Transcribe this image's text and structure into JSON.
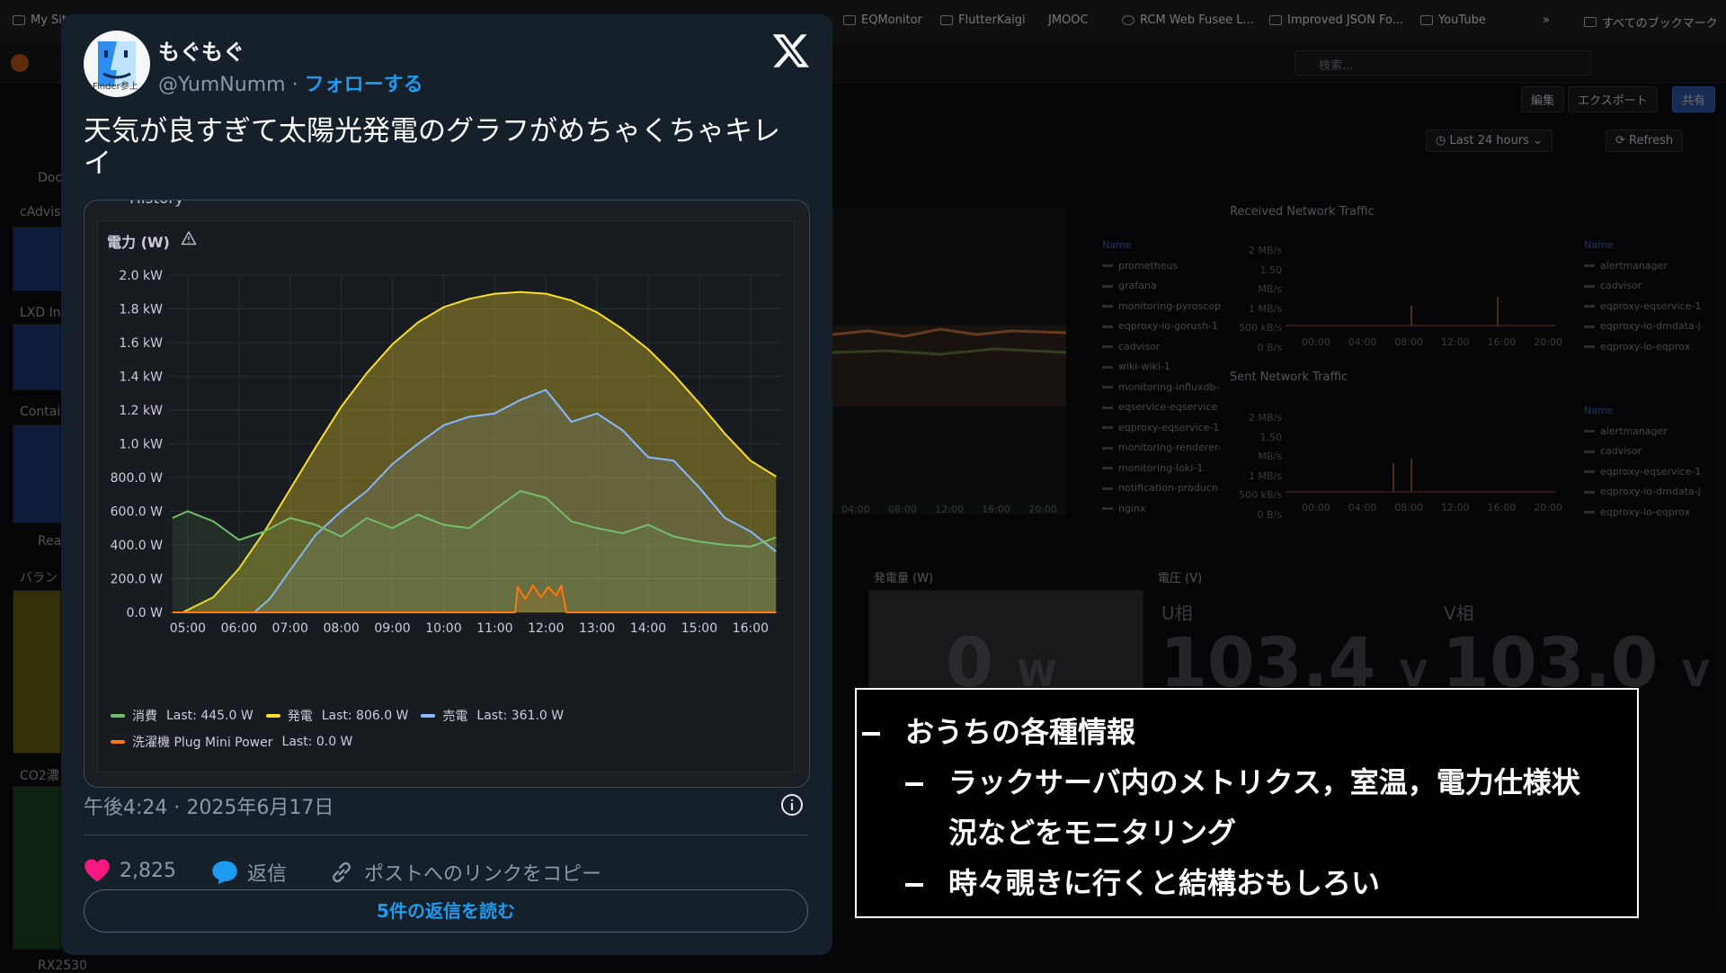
{
  "browser": {
    "bookmarks": [
      "My Sites",
      "EQMonitor",
      "FlutterKaigi",
      "JMOOC",
      "RCM Web Fusee L...",
      "Improved JSON Fo...",
      "YouTube",
      "すべてのブックマーク"
    ]
  },
  "grafana": {
    "search_placeholder": "検索...",
    "buttons": [
      "編集",
      "エクスポート",
      "共有"
    ],
    "time_range": "Last 24 hours",
    "refresh_label": "Refresh",
    "sidebar_labels": [
      "Doc",
      "cAdvis",
      "LXD In",
      "Contai",
      "Rea",
      "バラン",
      "CO2濃",
      "RX2530"
    ],
    "received_title": "Received Network Traffic",
    "sent_title": "Sent Network Traffic",
    "net_y_ticks": [
      "2 MB/s",
      "1.50 MB/s",
      "1 MB/s",
      "500 kB/s",
      "0 B/s"
    ],
    "net_x_ticks": [
      "00:00",
      "04:00",
      "08:00",
      "12:00",
      "16:00",
      "20:00"
    ],
    "left_x_ticks": [
      "04:00",
      "08:00",
      "12:00",
      "16:00",
      "20:00"
    ],
    "legend_header": "Name",
    "legend_left": [
      "prometheus",
      "grafana",
      "monitoring-pyroscop",
      "eqproxy-io-gorush-1",
      "cadvisor",
      "wiki-wiki-1",
      "monitoring-influxdb-",
      "eqservice-eqservice",
      "eqproxy-eqservice-1",
      "monitoring-renderer-",
      "monitoring-loki-1",
      "notification-producn",
      "nginx"
    ],
    "legend_right": [
      "alertmanager",
      "cadvisor",
      "eqproxy-eqservice-1",
      "eqproxy-io-dmdata-j",
      "eqproxy-io-eqprox"
    ],
    "gen_title": "発電量 (W)",
    "gen_value": "0",
    "gen_unit": "W",
    "volt_title": "電圧 (V)",
    "u_label": "U相",
    "u_value": "103.4",
    "v_label": "V相",
    "v_value": "103.0",
    "volt_unit": "V"
  },
  "tweet": {
    "author_name": "もぐもぐ",
    "handle": "@YumNumm",
    "separator": "·",
    "follow_label": "フォローする",
    "avatar_text": "Finder参上",
    "text": "天気が良すぎて太陽光発電のグラフがめちゃくちゃキレイ",
    "chart_header_partial": "History",
    "timestamp": "午後4:24 · 2025年6月17日",
    "likes": "2,825",
    "reply_label": "返信",
    "copy_link_label": "ポストへのリンクをコピー",
    "read_replies_label": "5件の返信を読む"
  },
  "chart_data": {
    "type": "line",
    "title": "電力 (W)",
    "y_ticks": [
      "0.0 W",
      "200.0 W",
      "400.0 W",
      "600.0 W",
      "800.0 W",
      "1.0 kW",
      "1.2 kW",
      "1.4 kW",
      "1.6 kW",
      "1.8 kW",
      "2.0 kW"
    ],
    "ylim": [
      0,
      2000
    ],
    "x_ticks": [
      "05:00",
      "06:00",
      "07:00",
      "08:00",
      "09:00",
      "10:00",
      "11:00",
      "12:00",
      "13:00",
      "14:00",
      "15:00",
      "16:00"
    ],
    "xlim": [
      4.65,
      16.6
    ],
    "series": [
      {
        "name": "消費",
        "color": "#73bf69",
        "last": "Last: 445.0 W",
        "x": [
          4.7,
          5.0,
          5.5,
          6.0,
          6.5,
          7.0,
          7.5,
          8.0,
          8.5,
          9.0,
          9.5,
          10.0,
          10.5,
          11.0,
          11.5,
          12.0,
          12.5,
          13.0,
          13.5,
          14.0,
          14.5,
          15.0,
          15.5,
          16.0,
          16.5
        ],
        "y": [
          560,
          600,
          540,
          430,
          480,
          560,
          520,
          450,
          560,
          500,
          580,
          520,
          500,
          610,
          720,
          680,
          540,
          500,
          470,
          520,
          450,
          420,
          400,
          390,
          445
        ]
      },
      {
        "name": "発電",
        "color": "#fade2a",
        "last": "Last: 806.0 W",
        "x": [
          4.9,
          5.5,
          6.0,
          6.5,
          7.0,
          7.5,
          8.0,
          8.5,
          9.0,
          9.5,
          10.0,
          10.5,
          11.0,
          11.5,
          12.0,
          12.5,
          13.0,
          13.5,
          14.0,
          14.5,
          15.0,
          15.5,
          16.0,
          16.5
        ],
        "y": [
          0,
          90,
          260,
          480,
          730,
          980,
          1220,
          1420,
          1590,
          1720,
          1810,
          1860,
          1890,
          1900,
          1890,
          1850,
          1780,
          1680,
          1560,
          1410,
          1240,
          1060,
          900,
          806
        ]
      },
      {
        "name": "売電",
        "color": "#8ab8ff",
        "last": "Last: 361.0 W",
        "x": [
          6.3,
          6.6,
          7.0,
          7.5,
          8.0,
          8.5,
          9.0,
          9.5,
          10.0,
          10.5,
          11.0,
          11.5,
          12.0,
          12.5,
          13.0,
          13.5,
          14.0,
          14.5,
          15.0,
          15.5,
          16.0,
          16.5
        ],
        "y": [
          0,
          80,
          250,
          460,
          600,
          720,
          880,
          1000,
          1110,
          1160,
          1180,
          1260,
          1320,
          1130,
          1180,
          1080,
          920,
          900,
          740,
          560,
          480,
          361
        ]
      },
      {
        "name": "洗濯機 Plug Mini Power",
        "color": "#ff780a",
        "last": "Last: 0.0 W",
        "x": [
          4.7,
          11.4,
          11.45,
          11.6,
          11.75,
          11.9,
          12.05,
          12.2,
          12.3,
          12.4,
          12.5,
          16.5
        ],
        "y": [
          0,
          0,
          150,
          80,
          160,
          90,
          150,
          100,
          160,
          0,
          0,
          0
        ]
      }
    ]
  },
  "slide": {
    "bullets": [
      {
        "level": 1,
        "text": "おうちの各種情報"
      },
      {
        "level": 2,
        "text": "ラックサーバ内のメトリクス，室温，電力仕様状"
      },
      {
        "level": 0,
        "text": "況などをモニタリング"
      },
      {
        "level": 2,
        "text": "時々覗きに行くと結構おもしろい"
      }
    ]
  }
}
